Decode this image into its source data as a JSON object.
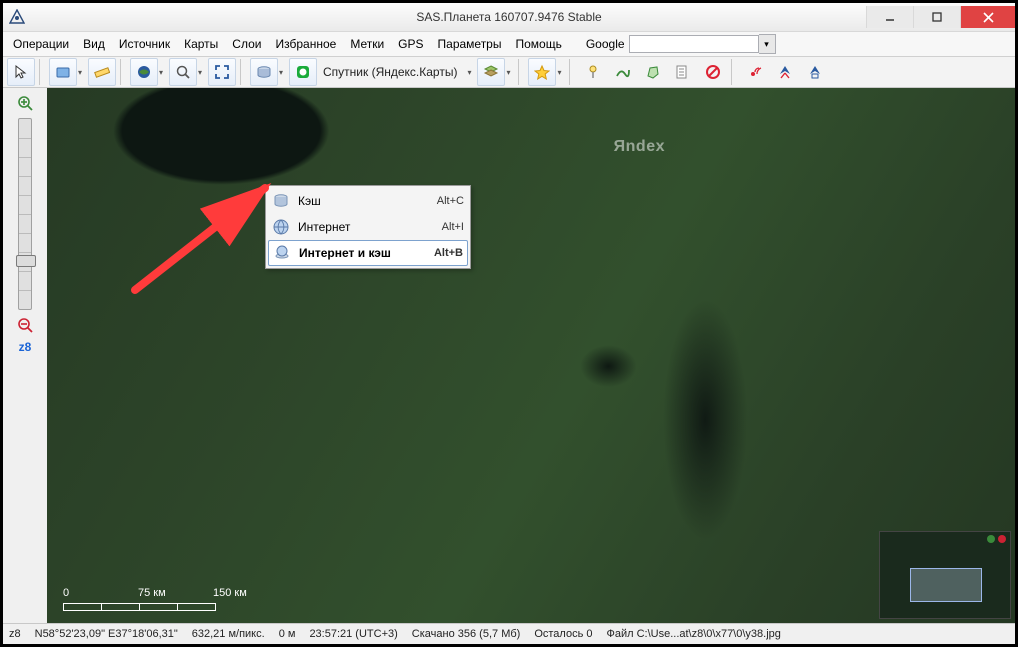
{
  "window": {
    "title": "SAS.Планета 160707.9476 Stable"
  },
  "menus": {
    "operations": "Операции",
    "view": "Вид",
    "source": "Источник",
    "maps": "Карты",
    "layers": "Слои",
    "favorites": "Избранное",
    "marks": "Метки",
    "gps": "GPS",
    "params": "Параметры",
    "help": "Помощь"
  },
  "search": {
    "provider": "Google",
    "value": ""
  },
  "toolbar": {
    "map_label": "Спутник (Яндекс.Карты)"
  },
  "dropdown": {
    "items": [
      {
        "label": "Кэш",
        "shortcut": "Alt+C",
        "selected": false
      },
      {
        "label": "Интернет",
        "shortcut": "Alt+I",
        "selected": false
      },
      {
        "label": "Интернет и кэш",
        "shortcut": "Alt+B",
        "selected": true
      }
    ]
  },
  "sidebar": {
    "zoom_level": "z8"
  },
  "map": {
    "watermark": "Яndex",
    "scale": {
      "labels": [
        "0",
        "75 км",
        "150 км"
      ]
    }
  },
  "status": {
    "zoom": "z8",
    "coords": "N58°52'23,09\" E37°18'06,31\"",
    "mpp": "632,21 м/пикс.",
    "elev": "0 м",
    "time": "23:57:21 (UTC+3)",
    "downloaded": "Скачано 356 (5,7 Мб)",
    "remaining": "Осталось 0",
    "file": "Файл C:\\Use...at\\z8\\0\\x77\\0\\y38.jpg"
  }
}
